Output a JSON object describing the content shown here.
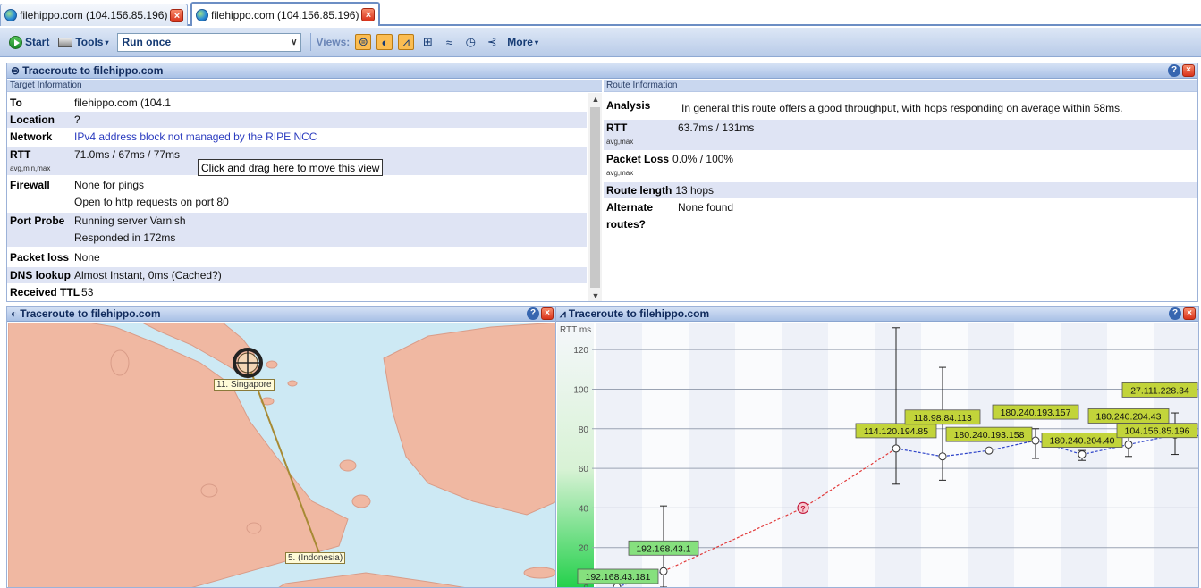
{
  "tabs": [
    {
      "label": "filehippo.com (104.156.85.196)"
    },
    {
      "label": "filehippo.com (104.156.85.196)"
    }
  ],
  "toolbar": {
    "start_label": "Start",
    "tools_label": "Tools",
    "run_mode": "Run once",
    "views_label": "Views:",
    "more_label": "More",
    "view_icons": [
      "summary-view-icon",
      "map-view-icon",
      "graph-view-icon",
      "table-view-icon",
      "timeline-view-icon",
      "clock-view-icon",
      "network-view-icon"
    ]
  },
  "summary_panel": {
    "title": "Traceroute to filehippo.com",
    "target_header": "Target Information",
    "route_header": "Route Information",
    "tooltip": "Click and drag here to move this view",
    "target": {
      "to_label": "To",
      "to_value": "filehippo.com (104.1",
      "location_label": "Location",
      "location_value": "?",
      "network_label": "Network",
      "network_value": "IPv4 address block not managed by the RIPE NCC",
      "rtt_label": "RTT",
      "rtt_sub": "avg,min,max",
      "rtt_value": "71.0ms / 67ms / 77ms",
      "firewall_label": "Firewall",
      "firewall_value1": "None for pings",
      "firewall_value2": "Open to http requests on port 80",
      "probe_label": "Port Probe",
      "probe_value1": "Running server Varnish",
      "probe_value2": "Responded in 172ms",
      "loss_label": "Packet loss",
      "loss_value": "None",
      "dns_label": "DNS lookup",
      "dns_value": "Almost Instant, 0ms (Cached?)",
      "ttl_label": "Received TTL",
      "ttl_value": "53"
    },
    "route": {
      "analysis_label": "Analysis",
      "analysis_value": "In general this route offers a good throughput, with hops responding on average within 58ms.",
      "rtt_label": "RTT",
      "rtt_sub": "avg,max",
      "rtt_value": "63.7ms / 131ms",
      "loss_label": "Packet Loss",
      "loss_sub": "avg,max",
      "loss_value": "0.0% / 100%",
      "length_label": "Route length",
      "length_value": "13 hops",
      "alt_label1": "Alternate",
      "alt_label2": "routes?",
      "alt_value": "None found"
    }
  },
  "map_panel": {
    "title": "Traceroute to filehippo.com",
    "labels": {
      "singapore": "11. Singapore",
      "indonesia": "5. (Indonesia)"
    },
    "colors": {
      "water": "#cde9f4",
      "land": "#f0b8a2",
      "route": "#a78a34"
    }
  },
  "graph_panel": {
    "title": "Traceroute to filehippo.com"
  },
  "chart_data": {
    "type": "line",
    "ylabel": "RTT ms",
    "ylim": [
      0,
      130
    ],
    "yticks": [
      20,
      40,
      60,
      80,
      100,
      120
    ],
    "grid": true,
    "hops": [
      {
        "hop": 1,
        "label": "192.168.43.181",
        "avg": 0,
        "min": 0,
        "max": 0,
        "color": "#86e07e"
      },
      {
        "hop": 2,
        "label": "192.168.43.1",
        "avg": 8,
        "min": 0,
        "max": 41,
        "color": "#86e07e"
      },
      {
        "hop": 5,
        "label": "",
        "avg": 40,
        "min": 40,
        "max": 40,
        "unknown": true
      },
      {
        "hop": 7,
        "label": "114.120.194.85",
        "avg": 70,
        "min": 52,
        "max": 131,
        "color": "#c2d43a"
      },
      {
        "hop": 8,
        "label": "118.98.84.113",
        "avg": 66,
        "min": 54,
        "max": 111,
        "color": "#c2d43a"
      },
      {
        "hop": 9,
        "label": "180.240.193.158",
        "avg": 69,
        "min": 69,
        "max": 69,
        "color": "#c2d43a"
      },
      {
        "hop": 10,
        "label": "180.240.193.157",
        "avg": 74,
        "min": 65,
        "max": 80,
        "color": "#c2d43a"
      },
      {
        "hop": 11,
        "label": "180.240.204.40",
        "avg": 67,
        "min": 64,
        "max": 69,
        "color": "#c2d43a"
      },
      {
        "hop": 12,
        "label": "180.240.204.43",
        "avg": 72,
        "min": 66,
        "max": 80,
        "color": "#c2d43a"
      },
      {
        "hop": 13,
        "label": "27.111.228.34",
        "avg": 77,
        "min": 67,
        "max": 88,
        "color": "#c2d43a"
      },
      {
        "hop": 14,
        "label": "",
        "avg": 76,
        "min": 76,
        "max": 76,
        "dest_marker": true
      },
      {
        "hop": 15,
        "label": "104.156.85.196",
        "avg": 71,
        "min": 67,
        "max": 75,
        "color": "#c2d43a"
      }
    ]
  }
}
